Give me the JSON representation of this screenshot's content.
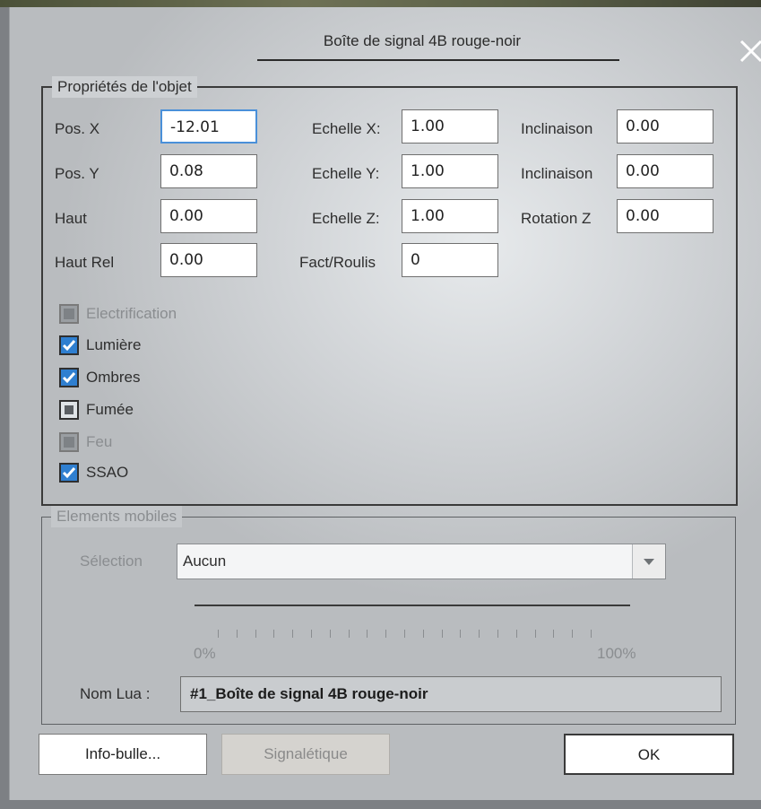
{
  "dialog": {
    "title": "Boîte de signal 4B rouge-noir"
  },
  "icons": {
    "close": "close-icon",
    "dropdown": "chevron-down-icon"
  },
  "colors": {
    "check_accent": "#2f7fd0",
    "focus_border": "#4a90d9"
  },
  "properties": {
    "legend": "Propriétés de l'objet",
    "pos_x": {
      "label": "Pos. X",
      "value": "-12.01"
    },
    "pos_y": {
      "label": "Pos. Y",
      "value": "0.08"
    },
    "haut": {
      "label": "Haut",
      "value": "0.00"
    },
    "haut_rel": {
      "label": "Haut Rel",
      "value": "0.00"
    },
    "echelle_x": {
      "label": "Echelle X:",
      "value": "1.00"
    },
    "echelle_y": {
      "label": "Echelle Y:",
      "value": "1.00"
    },
    "echelle_z": {
      "label": "Echelle Z:",
      "value": "1.00"
    },
    "fact_roulis": {
      "label": "Fact/Roulis",
      "value": "0"
    },
    "inclinaison_1": {
      "label": "Inclinaison",
      "value": "0.00"
    },
    "inclinaison_2": {
      "label": "Inclinaison",
      "value": "0.00"
    },
    "rotation_z": {
      "label": "Rotation Z",
      "value": "0.00"
    },
    "checkboxes": {
      "electrification": {
        "label": "Electrification",
        "state": "disabled"
      },
      "lumiere": {
        "label": "Lumière",
        "state": "checked"
      },
      "ombres": {
        "label": "Ombres",
        "state": "checked"
      },
      "fumee": {
        "label": "Fumée",
        "state": "indeterminate"
      },
      "feu": {
        "label": "Feu",
        "state": "disabled"
      },
      "ssao": {
        "label": "SSAO",
        "state": "checked"
      }
    }
  },
  "moving": {
    "legend": "Elements mobiles",
    "selection_label": "Sélection",
    "selection_value": "Aucun",
    "slider_min": "0%",
    "slider_max": "100%",
    "slider_value": 0,
    "lua_label": "Nom Lua :",
    "lua_value": "#1_Boîte de signal 4B rouge-noir"
  },
  "buttons": {
    "info": "Info-bulle...",
    "signaletique": "Signalétique",
    "ok": "OK"
  }
}
